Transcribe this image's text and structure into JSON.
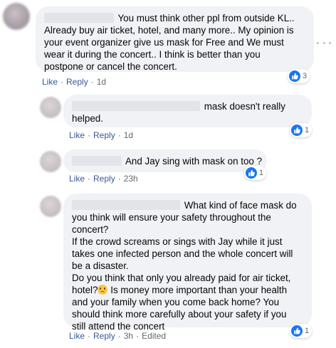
{
  "comments": [
    {
      "lines": [
        "You must think other ppl from outside KL..",
        "Already buy air ticket, hotel, and many more.. My opinion is",
        "your event organizer give us mask for Free and We must",
        "wear it during the concert.. I think is better than you",
        "postpone or cancel the concert."
      ],
      "actions": {
        "like": "Like",
        "reply": "Reply",
        "time": "1d"
      },
      "reactions": {
        "count": "3",
        "icon": "like-icon"
      }
    },
    {
      "lines": [
        "mask doesn't really",
        "helped."
      ],
      "actions": {
        "like": "Like",
        "reply": "Reply",
        "time": "1d"
      },
      "reactions": {
        "count": "1",
        "icon": "like-icon"
      }
    },
    {
      "lines": [
        "And Jay sing with mask on too ?"
      ],
      "actions": {
        "like": "Like",
        "reply": "Reply",
        "time": "23h"
      },
      "reactions": {
        "count": "1",
        "icon": "like-icon"
      }
    },
    {
      "lines": [
        "What kind of face mask do",
        "you think will ensure your safety throughout the",
        "concert?",
        "If the crowd screams or sings with Jay while it just",
        "takes one infected person and the whole concert will",
        "be a disaster.",
        "Do you think that only you already paid for air ticket,",
        "hotel?",
        "Is money more important than your health",
        "and your family when you come back home? You",
        "should think more carefully about your safety if you",
        "still attend the concert"
      ],
      "actions": {
        "like": "Like",
        "reply": "Reply",
        "time": "3h",
        "edited": "Edited"
      },
      "reactions": {
        "count": "1",
        "icon": "like-icon"
      }
    }
  ],
  "colors": {
    "bubble": "#f0f2f5",
    "link": "#385898",
    "meta": "#65676b",
    "like_blue": "#1877f2"
  },
  "icons": [
    "more-options-icon",
    "like-icon",
    "sad-face-emoji"
  ]
}
